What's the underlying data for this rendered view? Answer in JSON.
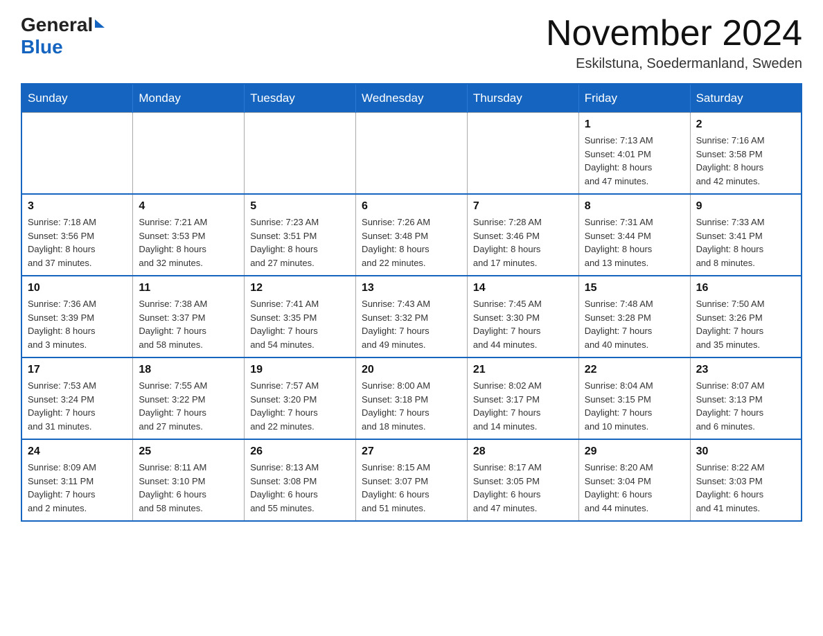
{
  "header": {
    "logo_general": "General",
    "logo_blue": "Blue",
    "month_title": "November 2024",
    "location": "Eskilstuna, Soedermanland, Sweden"
  },
  "weekdays": [
    "Sunday",
    "Monday",
    "Tuesday",
    "Wednesday",
    "Thursday",
    "Friday",
    "Saturday"
  ],
  "weeks": [
    [
      {
        "day": "",
        "info": ""
      },
      {
        "day": "",
        "info": ""
      },
      {
        "day": "",
        "info": ""
      },
      {
        "day": "",
        "info": ""
      },
      {
        "day": "",
        "info": ""
      },
      {
        "day": "1",
        "info": "Sunrise: 7:13 AM\nSunset: 4:01 PM\nDaylight: 8 hours\nand 47 minutes."
      },
      {
        "day": "2",
        "info": "Sunrise: 7:16 AM\nSunset: 3:58 PM\nDaylight: 8 hours\nand 42 minutes."
      }
    ],
    [
      {
        "day": "3",
        "info": "Sunrise: 7:18 AM\nSunset: 3:56 PM\nDaylight: 8 hours\nand 37 minutes."
      },
      {
        "day": "4",
        "info": "Sunrise: 7:21 AM\nSunset: 3:53 PM\nDaylight: 8 hours\nand 32 minutes."
      },
      {
        "day": "5",
        "info": "Sunrise: 7:23 AM\nSunset: 3:51 PM\nDaylight: 8 hours\nand 27 minutes."
      },
      {
        "day": "6",
        "info": "Sunrise: 7:26 AM\nSunset: 3:48 PM\nDaylight: 8 hours\nand 22 minutes."
      },
      {
        "day": "7",
        "info": "Sunrise: 7:28 AM\nSunset: 3:46 PM\nDaylight: 8 hours\nand 17 minutes."
      },
      {
        "day": "8",
        "info": "Sunrise: 7:31 AM\nSunset: 3:44 PM\nDaylight: 8 hours\nand 13 minutes."
      },
      {
        "day": "9",
        "info": "Sunrise: 7:33 AM\nSunset: 3:41 PM\nDaylight: 8 hours\nand 8 minutes."
      }
    ],
    [
      {
        "day": "10",
        "info": "Sunrise: 7:36 AM\nSunset: 3:39 PM\nDaylight: 8 hours\nand 3 minutes."
      },
      {
        "day": "11",
        "info": "Sunrise: 7:38 AM\nSunset: 3:37 PM\nDaylight: 7 hours\nand 58 minutes."
      },
      {
        "day": "12",
        "info": "Sunrise: 7:41 AM\nSunset: 3:35 PM\nDaylight: 7 hours\nand 54 minutes."
      },
      {
        "day": "13",
        "info": "Sunrise: 7:43 AM\nSunset: 3:32 PM\nDaylight: 7 hours\nand 49 minutes."
      },
      {
        "day": "14",
        "info": "Sunrise: 7:45 AM\nSunset: 3:30 PM\nDaylight: 7 hours\nand 44 minutes."
      },
      {
        "day": "15",
        "info": "Sunrise: 7:48 AM\nSunset: 3:28 PM\nDaylight: 7 hours\nand 40 minutes."
      },
      {
        "day": "16",
        "info": "Sunrise: 7:50 AM\nSunset: 3:26 PM\nDaylight: 7 hours\nand 35 minutes."
      }
    ],
    [
      {
        "day": "17",
        "info": "Sunrise: 7:53 AM\nSunset: 3:24 PM\nDaylight: 7 hours\nand 31 minutes."
      },
      {
        "day": "18",
        "info": "Sunrise: 7:55 AM\nSunset: 3:22 PM\nDaylight: 7 hours\nand 27 minutes."
      },
      {
        "day": "19",
        "info": "Sunrise: 7:57 AM\nSunset: 3:20 PM\nDaylight: 7 hours\nand 22 minutes."
      },
      {
        "day": "20",
        "info": "Sunrise: 8:00 AM\nSunset: 3:18 PM\nDaylight: 7 hours\nand 18 minutes."
      },
      {
        "day": "21",
        "info": "Sunrise: 8:02 AM\nSunset: 3:17 PM\nDaylight: 7 hours\nand 14 minutes."
      },
      {
        "day": "22",
        "info": "Sunrise: 8:04 AM\nSunset: 3:15 PM\nDaylight: 7 hours\nand 10 minutes."
      },
      {
        "day": "23",
        "info": "Sunrise: 8:07 AM\nSunset: 3:13 PM\nDaylight: 7 hours\nand 6 minutes."
      }
    ],
    [
      {
        "day": "24",
        "info": "Sunrise: 8:09 AM\nSunset: 3:11 PM\nDaylight: 7 hours\nand 2 minutes."
      },
      {
        "day": "25",
        "info": "Sunrise: 8:11 AM\nSunset: 3:10 PM\nDaylight: 6 hours\nand 58 minutes."
      },
      {
        "day": "26",
        "info": "Sunrise: 8:13 AM\nSunset: 3:08 PM\nDaylight: 6 hours\nand 55 minutes."
      },
      {
        "day": "27",
        "info": "Sunrise: 8:15 AM\nSunset: 3:07 PM\nDaylight: 6 hours\nand 51 minutes."
      },
      {
        "day": "28",
        "info": "Sunrise: 8:17 AM\nSunset: 3:05 PM\nDaylight: 6 hours\nand 47 minutes."
      },
      {
        "day": "29",
        "info": "Sunrise: 8:20 AM\nSunset: 3:04 PM\nDaylight: 6 hours\nand 44 minutes."
      },
      {
        "day": "30",
        "info": "Sunrise: 8:22 AM\nSunset: 3:03 PM\nDaylight: 6 hours\nand 41 minutes."
      }
    ]
  ]
}
